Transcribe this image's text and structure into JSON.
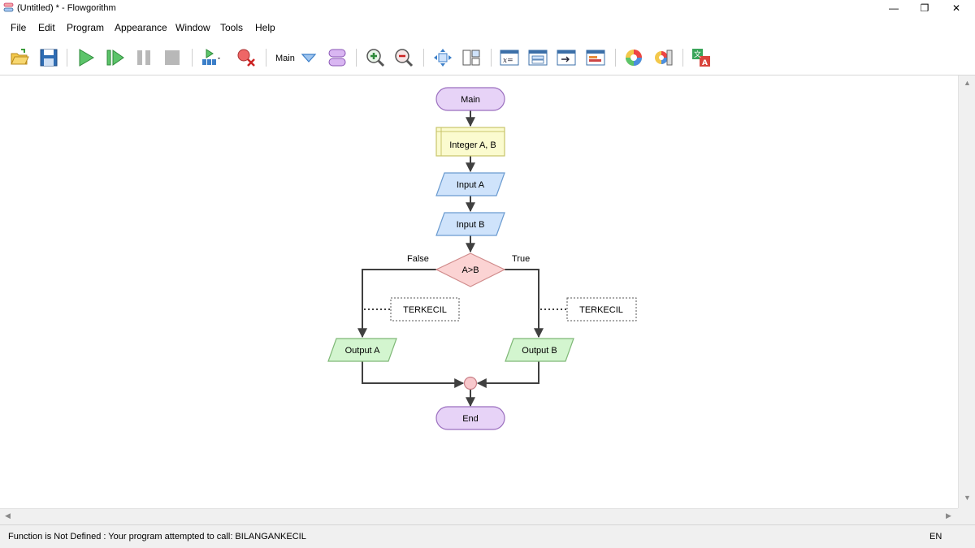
{
  "window": {
    "title": "(Untitled) * - Flowgorithm"
  },
  "menu": [
    "File",
    "Edit",
    "Program",
    "Appearance",
    "Window",
    "Tools",
    "Help"
  ],
  "toolbar": {
    "function_label": "Main"
  },
  "flowchart": {
    "start": "Main",
    "declare": "Integer A, B",
    "input_a": "Input A",
    "input_b": "Input B",
    "decision": "A>B",
    "false_label": "False",
    "true_label": "True",
    "call_left": "TERKECIL",
    "call_right": "TERKECIL",
    "output_a": "Output A",
    "output_b": "Output B",
    "end": "End"
  },
  "colors": {
    "terminal_fill": "#e7d3f7",
    "terminal_stroke": "#9b6fbf",
    "declare_fill": "#fbfbcf",
    "declare_stroke": "#c8c46b",
    "input_fill": "#cfe3fb",
    "input_stroke": "#6a9bd0",
    "decision_fill": "#fbd3d3",
    "decision_stroke": "#d08b8b",
    "output_fill": "#d3f5cf",
    "output_stroke": "#7fb877",
    "connector_fill": "#f8c8cc",
    "connector_stroke": "#c98088",
    "line": "#404040"
  },
  "status": {
    "message": "Function is Not Defined : Your program attempted to call: BILANGANKECIL",
    "language": "EN"
  }
}
